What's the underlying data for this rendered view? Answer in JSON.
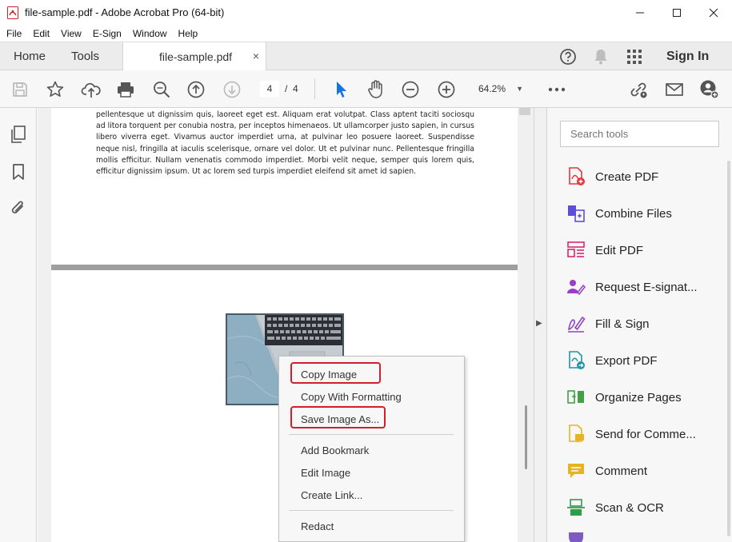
{
  "window": {
    "title": "file-sample.pdf - Adobe Acrobat Pro (64-bit)",
    "controls": [
      "minimize",
      "maximize",
      "close"
    ]
  },
  "menubar": [
    "File",
    "Edit",
    "View",
    "E-Sign",
    "Window",
    "Help"
  ],
  "tabs": {
    "home": "Home",
    "tools": "Tools",
    "document": "file-sample.pdf",
    "document_close": "×",
    "sign_in": "Sign In"
  },
  "toolbar": {
    "current_page": "4",
    "page_separator": "/",
    "total_pages": "4",
    "zoom": "64.2%"
  },
  "document": {
    "text": "pellentesque ut dignissim quis, laoreet eget est. Aliquam erat volutpat. Class aptent taciti sociosqu ad litora torquent per conubia nostra, per inceptos himenaeos. Ut ullamcorper justo sapien, in cursus libero viverra eget. Vivamus auctor imperdiet urna, at pulvinar leo posuere laoreet. Suspendisse neque nisl, fringilla at iaculis scelerisque, ornare vel dolor. Ut et pulvinar nunc. Pellentesque fringilla mollis efficitur. Nullam venenatis commodo imperdiet. Morbi velit neque, semper quis lorem quis, efficitur dignissim ipsum. Ut ac lorem sed turpis imperdiet eleifend sit amet id sapien."
  },
  "context_menu": {
    "items": [
      "Copy Image",
      "Copy With Formatting",
      "Save Image As...",
      "Add Bookmark",
      "Edit Image",
      "Create Link...",
      "Redact"
    ]
  },
  "tools_pane": {
    "search_placeholder": "Search tools",
    "items": [
      {
        "label": "Create PDF",
        "color": "#e0393e"
      },
      {
        "label": "Combine Files",
        "color": "#5b4fd8"
      },
      {
        "label": "Edit PDF",
        "color": "#d6286f"
      },
      {
        "label": "Request E-signat...",
        "color": "#9b3dc9"
      },
      {
        "label": "Fill & Sign",
        "color": "#8e44c7"
      },
      {
        "label": "Export PDF",
        "color": "#2196a6"
      },
      {
        "label": "Organize Pages",
        "color": "#43a047"
      },
      {
        "label": "Send for Comme...",
        "color": "#e6b422"
      },
      {
        "label": "Comment",
        "color": "#e6b422"
      },
      {
        "label": "Scan & OCR",
        "color": "#2e9d4a"
      }
    ]
  },
  "colors": {
    "highlight": "#d11f2b",
    "select_tool": "#1473e6"
  }
}
